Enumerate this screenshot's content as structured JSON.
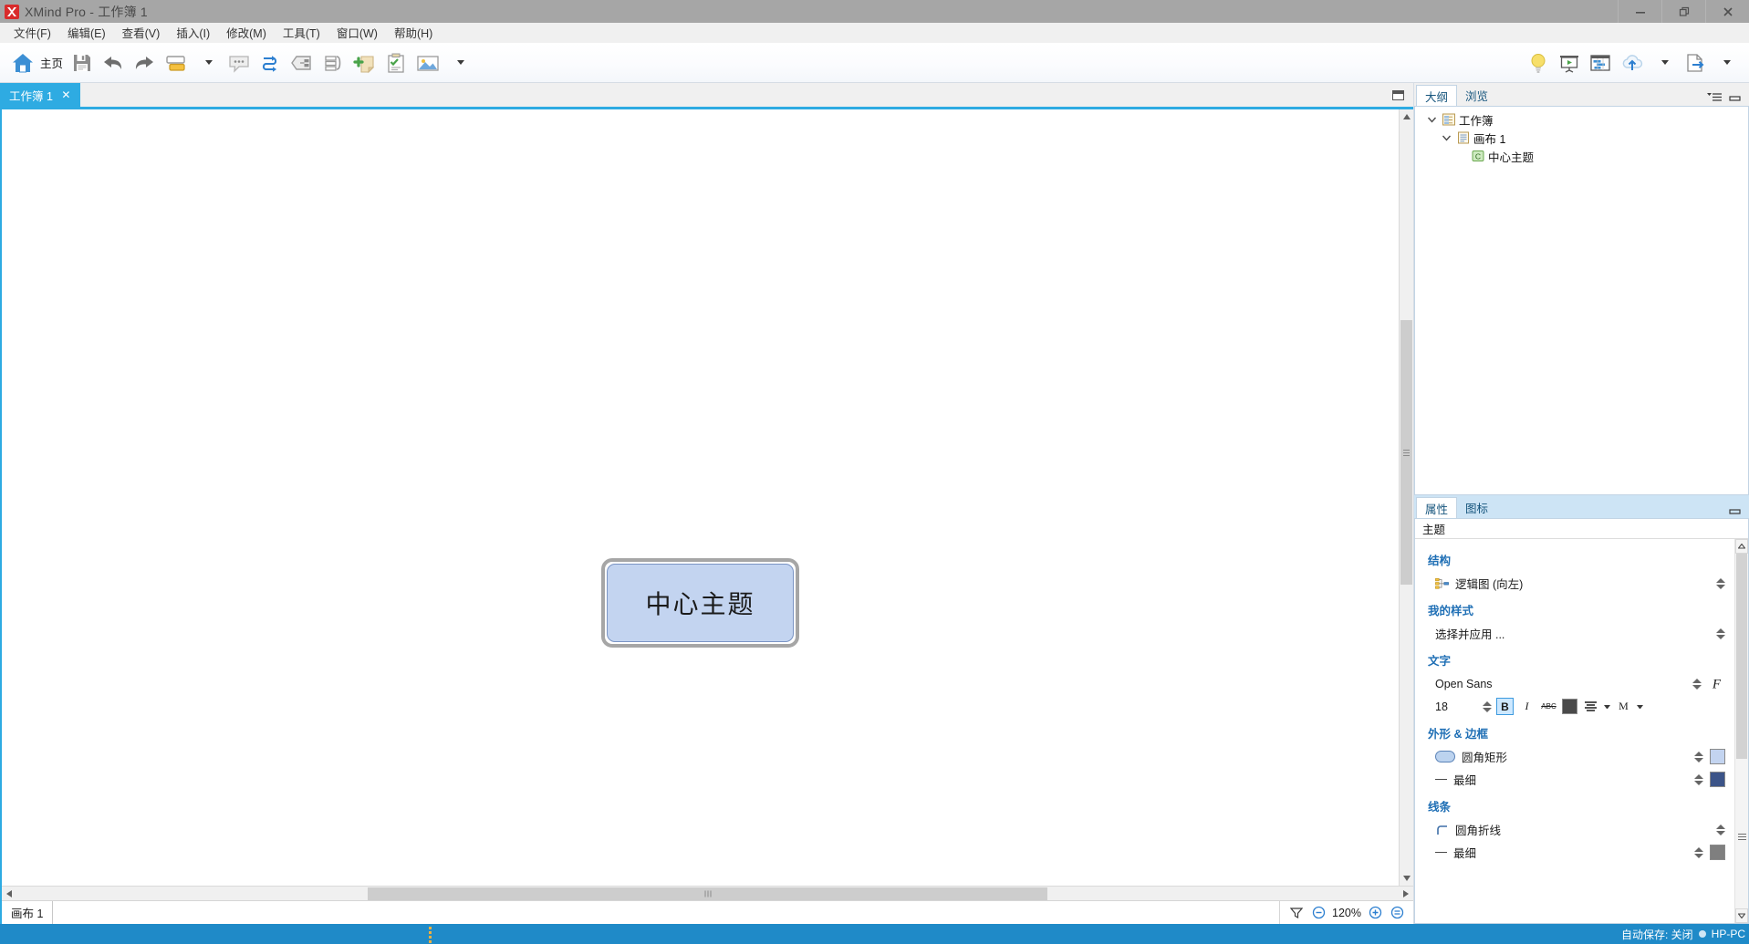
{
  "window": {
    "title": "XMind Pro - 工作簿 1",
    "app_icon": "xmind-logo-icon",
    "controls": {
      "minimize": "—",
      "restore": "❐",
      "close": "✕"
    }
  },
  "menubar": {
    "items": [
      {
        "label": "文件(F)",
        "name": "menu-file"
      },
      {
        "label": "编辑(E)",
        "name": "menu-edit"
      },
      {
        "label": "查看(V)",
        "name": "menu-view"
      },
      {
        "label": "插入(I)",
        "name": "menu-insert"
      },
      {
        "label": "修改(M)",
        "name": "menu-modify"
      },
      {
        "label": "工具(T)",
        "name": "menu-tools"
      },
      {
        "label": "窗口(W)",
        "name": "menu-window"
      },
      {
        "label": "帮助(H)",
        "name": "menu-help"
      }
    ]
  },
  "toolbar": {
    "home_label": "主页",
    "left_items": [
      {
        "name": "home-icon",
        "tip": "主页"
      },
      {
        "name": "save-icon",
        "tip": "保存"
      },
      {
        "name": "undo-icon",
        "tip": "撤销"
      },
      {
        "name": "redo-icon",
        "tip": "重做"
      },
      {
        "name": "topic-icon",
        "tip": "主题"
      },
      {
        "name": "callout-icon",
        "tip": "标注"
      },
      {
        "name": "relationship-icon",
        "tip": "联系"
      },
      {
        "name": "boundary-icon",
        "tip": "外框"
      },
      {
        "name": "summary-icon",
        "tip": "概要"
      },
      {
        "name": "note-icon",
        "tip": "备注"
      },
      {
        "name": "task-icon",
        "tip": "任务信息"
      },
      {
        "name": "image-icon",
        "tip": "图片"
      }
    ],
    "right_items": [
      {
        "name": "brainstorm-bulb-icon",
        "tip": "头脑风暴"
      },
      {
        "name": "presentation-icon",
        "tip": "演示"
      },
      {
        "name": "gantt-icon",
        "tip": "甘特图"
      },
      {
        "name": "upload-cloud-icon",
        "tip": "上传"
      },
      {
        "name": "export-icon",
        "tip": "导出"
      }
    ]
  },
  "editor": {
    "tab": {
      "label": "工作簿 1",
      "close": "✕",
      "name": "tab-workbook-1"
    },
    "maximize_tip": "最大化",
    "topic": {
      "text": "中心主题",
      "fill": "#c3d4f0",
      "border": "#7a94c4",
      "selected": true
    }
  },
  "sheetbar": {
    "sheet_label": "画布 1",
    "filter_tip": "过滤",
    "zoom_out": "−",
    "zoom_value": "120%",
    "zoom_in": "+",
    "zoom_fit": "⊜"
  },
  "outline_panel": {
    "tabs": [
      {
        "label": "大纲",
        "active": true,
        "name": "tab-outline"
      },
      {
        "label": "浏览",
        "active": false,
        "name": "tab-browse"
      }
    ],
    "menu_icon": "view-menu-icon",
    "minimize_icon": "minimize-icon",
    "tree": [
      {
        "label": "工作簿",
        "depth": 0,
        "icon": "workbook-icon",
        "expanded": true
      },
      {
        "label": "画布 1",
        "depth": 1,
        "icon": "sheet-icon",
        "expanded": true
      },
      {
        "label": "中心主题",
        "depth": 2,
        "icon": "central-topic-icon",
        "expanded": null
      }
    ]
  },
  "properties_panel": {
    "tabs": [
      {
        "label": "属性",
        "active": true,
        "name": "tab-properties"
      },
      {
        "label": "图标",
        "active": false,
        "name": "tab-icons"
      }
    ],
    "minimize_icon": "minimize-icon",
    "section_title": "主题",
    "groups": [
      {
        "title": "结构",
        "name": "group-structure",
        "rows": [
          {
            "type": "select",
            "icon": "logic-chart-icon",
            "value": "逻辑图 (向左)",
            "name": "structure-select"
          }
        ]
      },
      {
        "title": "我的样式",
        "name": "group-my-style",
        "rows": [
          {
            "type": "select",
            "value": "选择并应用 ...",
            "name": "style-select"
          }
        ]
      },
      {
        "title": "文字",
        "name": "group-text",
        "rows": [
          {
            "type": "font",
            "value": "Open Sans",
            "name": "font-family-select"
          },
          {
            "type": "fontrow",
            "size": "18",
            "bold": "B",
            "italic": "I",
            "strike": "ABC",
            "color": "#4a4a4a",
            "align_icon": "align-center-icon",
            "case_label": "M",
            "name": "font-size-row"
          }
        ]
      },
      {
        "title": "外形 & 边框",
        "name": "group-shape-border",
        "rows": [
          {
            "type": "shape",
            "value": "圆角矩形",
            "color": "#c3d4f0",
            "name": "shape-select"
          },
          {
            "type": "line",
            "value": "最细",
            "color": "#3c5488",
            "name": "border-width-select"
          }
        ]
      },
      {
        "title": "线条",
        "name": "group-lines",
        "rows": [
          {
            "type": "linestyle",
            "value": "圆角折线",
            "name": "line-style-select"
          },
          {
            "type": "line",
            "value": "最细",
            "color": "#7f7f7f",
            "name": "line-width-select"
          }
        ]
      }
    ]
  },
  "statusbar": {
    "autosave": "自动保存: 关闭",
    "device": "HP-PC",
    "dot_color": "#cfe6f5"
  }
}
